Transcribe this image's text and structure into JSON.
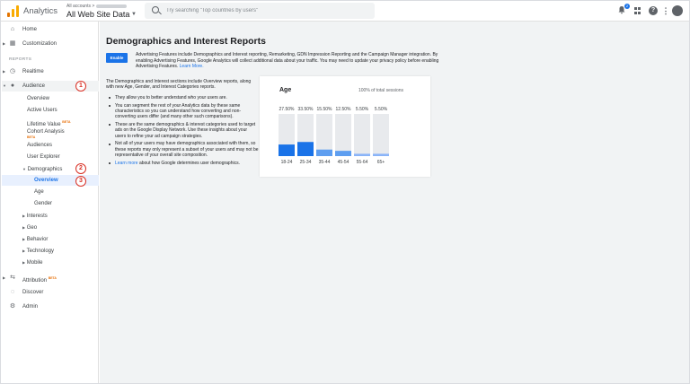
{
  "topbar": {
    "app_title": "Analytics",
    "account_crumb": "All accounts >",
    "account_name": "All Web Site Data",
    "search_placeholder": "Try searching \"Top countries by users\"",
    "notification_count": "2"
  },
  "sidebar": {
    "home": "Home",
    "customization": "Customization",
    "reports_label": "REPORTS",
    "realtime": "Realtime",
    "audience": "Audience",
    "audience_items": [
      "Overview",
      "Active Users",
      "Lifetime Value",
      "Cohort Analysis",
      "Audiences",
      "User Explorer"
    ],
    "beta": "BETA",
    "demographics": "Demographics",
    "demographics_items": [
      "Overview",
      "Age",
      "Gender"
    ],
    "more_items": [
      "Interests",
      "Geo",
      "Behavior",
      "Technology",
      "Mobile"
    ],
    "attribution": "Attribution",
    "discover": "Discover",
    "admin": "Admin",
    "callouts": [
      "1",
      "2",
      "3"
    ]
  },
  "main": {
    "title": "Demographics and Interest Reports",
    "enable_label": "Enable",
    "intro_text": "Advertising Features include Demographics and Interest reporting, Remarketing, GDN Impression Reporting and the Campaign Manager integration. By enabling Advertising Features, Google Analytics will collect additional data about your traffic. You may need to update your privacy policy before enabling Advertising Features.",
    "intro_link": "Learn More.",
    "description": "The Demographics and Interest sections include Overview reports, along with new Age, Gender, and Interest Categories reports.",
    "bullets": [
      "They allow you to better understand who your users are.",
      "You can segment the rest of your Analytics data by these same characteristics so you can understand how converting and non-converting users differ (and many other such comparisons).",
      "These are the same demographics & interest categories used to target ads on the Google Display Network. Use these insights about your users to refine your ad campaign strategies.",
      "Not all of your users may have demographics associated with them, so these reports may only represent a subset of your users and may not be representative of your overall site composition."
    ],
    "learn_more_link": "Learn more",
    "learn_more_rest": " about how Google determines user demographics."
  },
  "chart_data": {
    "type": "bar",
    "title": "Age",
    "subtitle": "100% of total sessions",
    "categories": [
      "18-24",
      "25-34",
      "35-44",
      "45-54",
      "55-64",
      "65+"
    ],
    "values": [
      27.5,
      33.5,
      15.5,
      12.5,
      5.5,
      5.5
    ],
    "value_labels": [
      "27.50%",
      "33.50%",
      "15.50%",
      "12.50%",
      "5.50%",
      "5.50%"
    ],
    "ylim": [
      0,
      100
    ],
    "colors": {
      "bar_track": "#e8eaed",
      "fills": [
        "#1a73e8",
        "#1a73e8",
        "#5e9ef0",
        "#5e9ef0",
        "#8ab4f8",
        "#8ab4f8"
      ]
    }
  }
}
